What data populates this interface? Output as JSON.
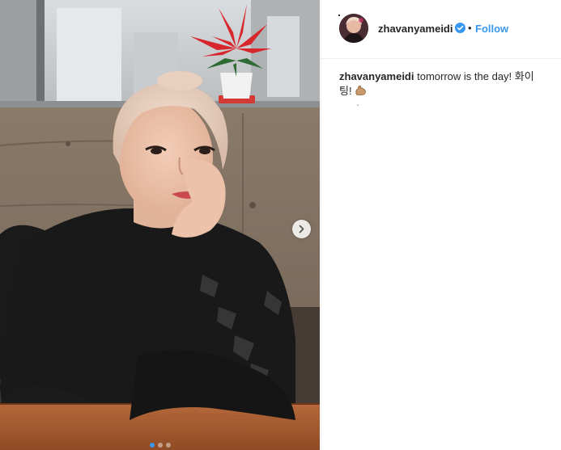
{
  "post": {
    "username": "zhavanyameidi",
    "separator": "•",
    "follow_label": "Follow",
    "caption_user": "zhavanyameidi",
    "caption_text": "tomorrow is the day! 화이팅!",
    "caption_emoji": "flexed-biceps"
  },
  "carousel": {
    "slide_count": 3,
    "active_index": 0,
    "next_icon": "chevron-right-icon"
  },
  "colors": {
    "accent": "#3897f0",
    "text": "#262626",
    "border": "#efefef"
  }
}
